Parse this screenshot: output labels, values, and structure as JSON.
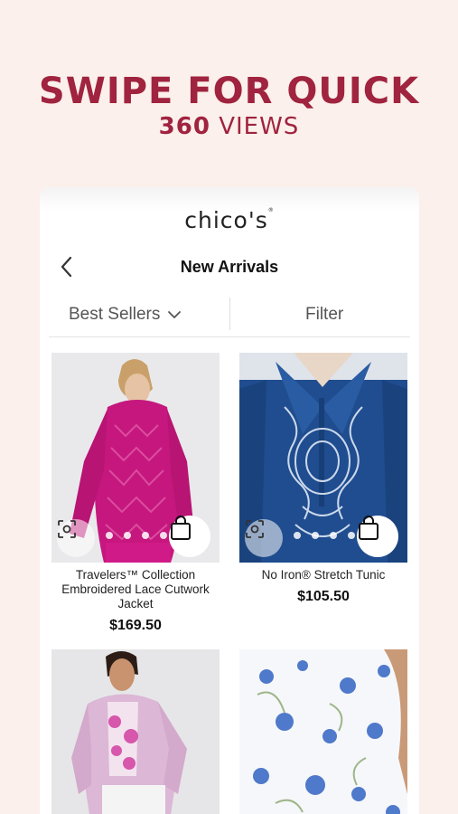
{
  "promo": {
    "line1": "SWIPE FOR QUICK",
    "line2_bold": "360",
    "line2_rest": " VIEWS",
    "color": "#a0233f"
  },
  "app": {
    "logo": "chico's"
  },
  "nav": {
    "back_icon": "chevron-left-icon",
    "title": "New Arrivals"
  },
  "toolbar": {
    "sort_label": "Best Sellers",
    "filter_label": "Filter"
  },
  "products": [
    {
      "name": "Travelers™ Collection Embroidered Lace Cutwork Jacket",
      "price": "$169.50",
      "image_dots": 5
    },
    {
      "name": "No Iron® Stretch Tunic",
      "price": "$105.50",
      "image_dots": 4
    },
    {
      "name": "",
      "price": ""
    },
    {
      "name": "",
      "price": ""
    }
  ]
}
